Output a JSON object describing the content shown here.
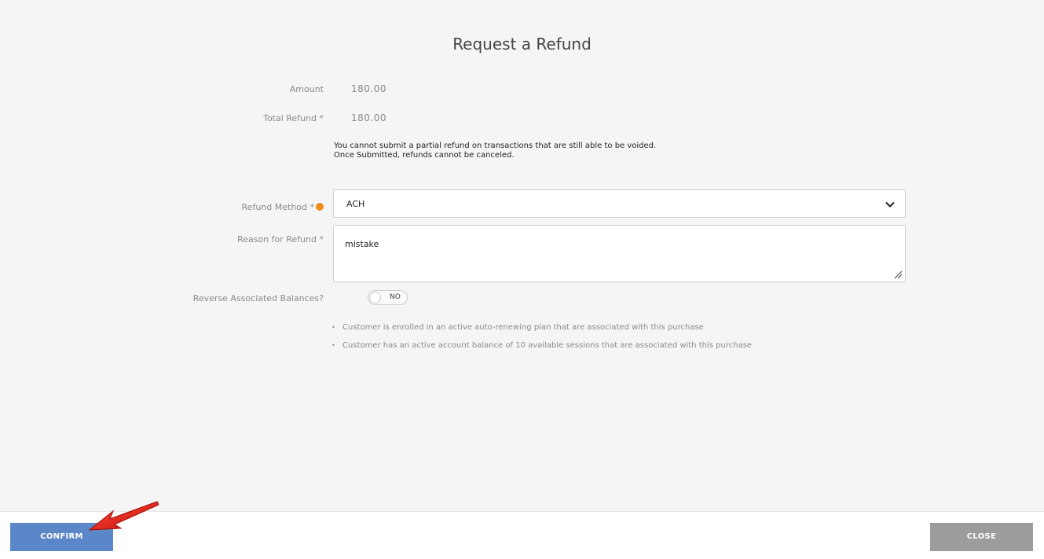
{
  "dialog": {
    "title": "Request a Refund"
  },
  "fields": {
    "amount_label": "Amount",
    "amount_value": "180.00",
    "total_refund_label": "Total Refund *",
    "total_refund_value": "180.00",
    "notice_line1": "You cannot submit a partial refund on transactions that are still able to be voided.",
    "notice_line2": "Once Submitted, refunds cannot be canceled.",
    "refund_method_label": "Refund Method *",
    "refund_method_value": "ACH",
    "reason_label": "Reason for Refund *",
    "reason_value": "mistake",
    "reverse_label": "Reverse Associated Balances?",
    "reverse_toggle_text": "NO"
  },
  "warnings": [
    "Customer is enrolled in an active auto-renewing plan that are associated with this purchase",
    "Customer has an active account balance of 10 available sessions that are associated with this purchase"
  ],
  "buttons": {
    "confirm": "CONFIRM",
    "close": "CLOSE"
  },
  "colors": {
    "confirm_bg": "#5b86c7",
    "close_bg": "#9c9c9c",
    "info_dot": "#f08c1d",
    "annotation_arrow": "#e02020"
  },
  "icons": {
    "select_chevron": "chevron-down-icon",
    "info": "info-icon",
    "resize": "resize-handle-icon",
    "annotation": "red-arrow-icon"
  }
}
